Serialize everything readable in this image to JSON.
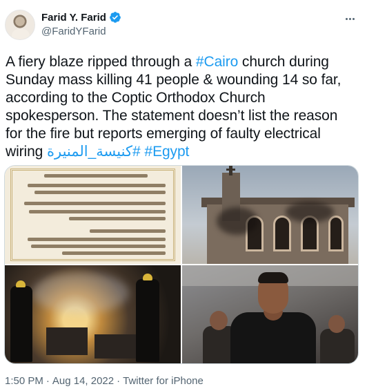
{
  "author": {
    "name": "Farid Y. Farid",
    "handle": "@FaridYFarid",
    "verified": true
  },
  "tweet": {
    "text_plain": "A fiery blaze ripped through a ",
    "hashtag_cairo": "#Cairo",
    "text_rest": " church during Sunday mass killing 41  people & wounding 14 so far, according to the Coptic Orthodox Church spokesperson. The statement doesn’t list the reason for the fire but reports emerging of faulty electrical wiring ",
    "hashtag_arabic": "#كنيسة_المنيرة",
    "hashtag_egypt": "#Egypt"
  },
  "media": {
    "photos": [
      {
        "name": "statement-document-photo"
      },
      {
        "name": "burned-church-photo"
      },
      {
        "name": "fire-interior-photo"
      },
      {
        "name": "man-in-smoke-photo"
      }
    ]
  },
  "meta": {
    "time": "1:50 PM",
    "separator": "·",
    "date": "Aug 14, 2022",
    "source": "Twitter for iPhone"
  },
  "colors": {
    "link": "#1d9bf0",
    "text": "#0f1419",
    "secondary": "#536471",
    "border": "#cfd9de"
  },
  "icons": [
    "verified-badge-icon",
    "more-options-icon"
  ]
}
